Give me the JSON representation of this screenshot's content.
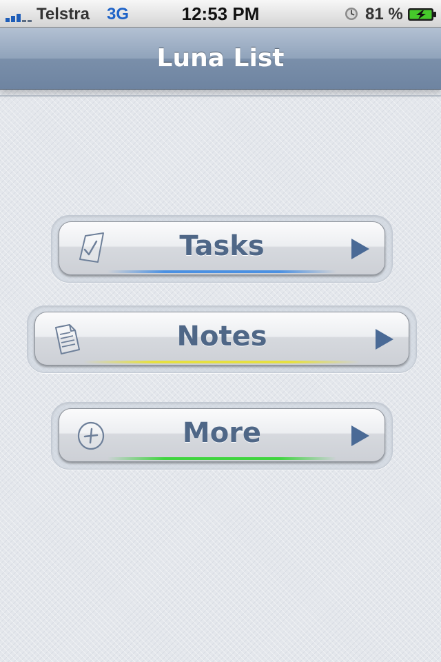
{
  "status_bar": {
    "carrier": "Telstra",
    "network": "3G",
    "time": "12:53 PM",
    "battery_percent": "81 %",
    "icons": [
      "signal-icon",
      "alarm-icon",
      "battery-charging-icon"
    ]
  },
  "nav": {
    "title": "Luna List"
  },
  "menu": {
    "items": [
      {
        "label": "Tasks",
        "icon": "checklist-icon",
        "accent_color": "#4a90e2"
      },
      {
        "label": "Notes",
        "icon": "note-icon",
        "accent_color": "#e6e040"
      },
      {
        "label": "More",
        "icon": "plus-circle-icon",
        "accent_color": "#3fd43f"
      }
    ]
  },
  "colors": {
    "nav_bar": "#8a9db6",
    "label_text": "#4f6787",
    "arrow": "#4a6a96"
  }
}
